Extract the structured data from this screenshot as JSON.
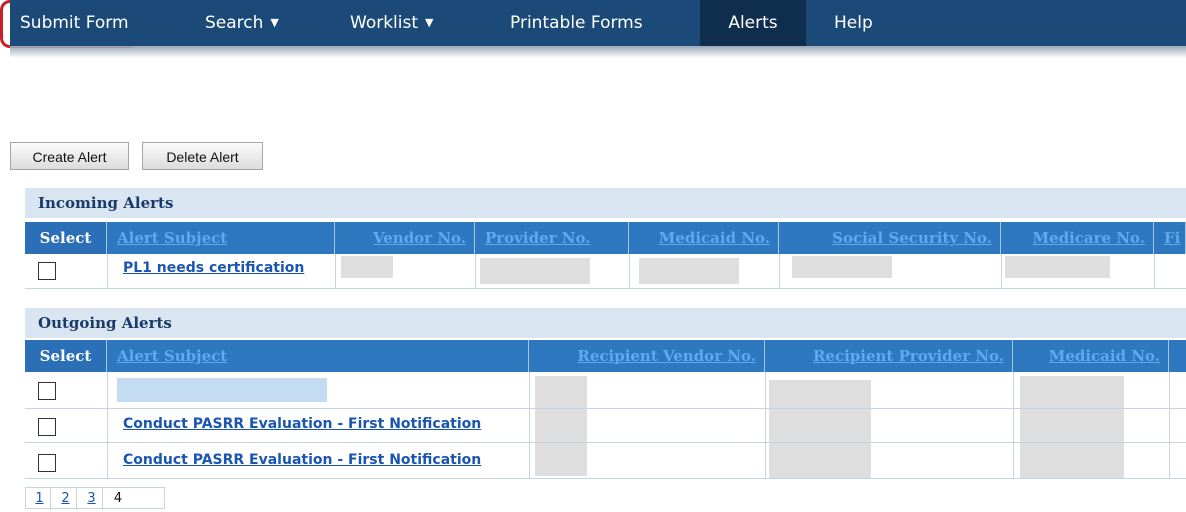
{
  "nav": {
    "items": [
      {
        "label": "Submit Form",
        "caret": ""
      },
      {
        "label": "Search",
        "caret": "▼"
      },
      {
        "label": "Worklist",
        "caret": "▼"
      },
      {
        "label": "Printable Forms",
        "caret": ""
      },
      {
        "label": "Alerts",
        "caret": ""
      },
      {
        "label": "Help",
        "caret": ""
      }
    ],
    "active": "Alerts"
  },
  "toolbar": {
    "create_label": "Create Alert",
    "delete_label": "Delete Alert",
    "highlight_color": "#c8202b"
  },
  "incoming": {
    "title": "Incoming Alerts",
    "columns": [
      "Select",
      "Alert Subject",
      "Vendor No.",
      "Provider No.",
      "Medicaid No.",
      "Social Security No.",
      "Medicare No.",
      "Fi"
    ],
    "rows": [
      {
        "subject": "PL1 needs certification",
        "checked": false
      }
    ]
  },
  "outgoing": {
    "title": "Outgoing Alerts",
    "columns": [
      "Select",
      "Alert Subject",
      "Recipient Vendor No.",
      "Recipient Provider No.",
      "Medicaid No."
    ],
    "rows": [
      {
        "subject": "",
        "checked": false
      },
      {
        "subject": "Conduct PASRR Evaluation - First Notification",
        "checked": false
      },
      {
        "subject": "Conduct PASRR Evaluation - First Notification",
        "checked": false
      }
    ]
  },
  "pager": {
    "pages": [
      "1",
      "2",
      "3",
      "4"
    ],
    "current": "4"
  },
  "colors": {
    "nav_bg": "#1c4a78",
    "header_bg": "#2e78c0",
    "section_bg": "#d9e6f1",
    "link": "#1a55b0"
  }
}
